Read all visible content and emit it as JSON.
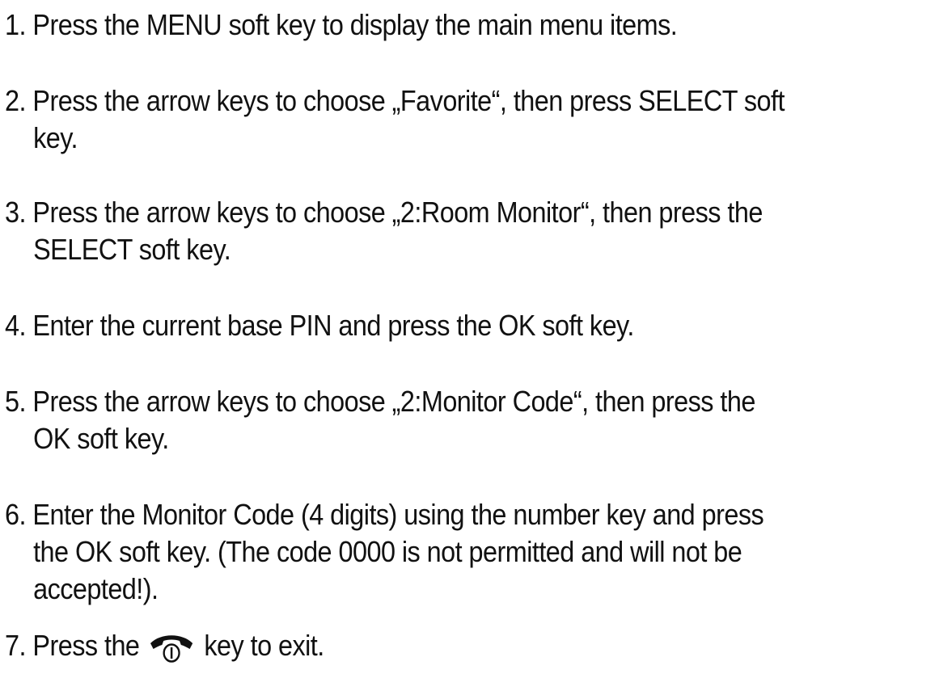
{
  "steps": [
    {
      "number": "1.",
      "lines": [
        "Press the MENU soft key to display the main menu items."
      ]
    },
    {
      "number": "2.",
      "lines": [
        "Press the arrow keys to choose „Favorite“, then press SELECT soft",
        "key."
      ]
    },
    {
      "number": "3.",
      "lines": [
        "Press the arrow keys to choose „2:Room Monitor“, then press the",
        "SELECT soft key."
      ]
    },
    {
      "number": "4.",
      "lines": [
        "Enter the current base PIN and press the OK soft key."
      ]
    },
    {
      "number": "5.",
      "lines": [
        "Press the arrow keys to choose „2:Monitor Code“, then press the",
        "OK soft key."
      ]
    },
    {
      "number": "6.",
      "lines": [
        "Enter the Monitor Code (4 digits) using the number key and press",
        "the OK soft key. (The code 0000 is not permitted and will not be",
        "accepted!)."
      ]
    },
    {
      "number": "7.",
      "before_icon": "Press the",
      "icon": "end-call-key-icon",
      "after_icon": "key to exit."
    }
  ]
}
